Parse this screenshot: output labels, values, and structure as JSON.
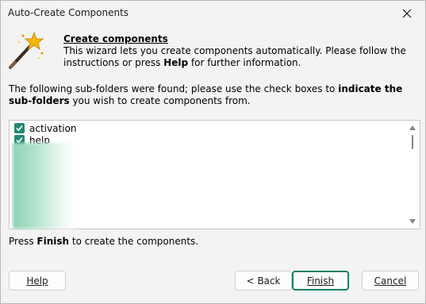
{
  "window": {
    "title": "Auto-Create Components"
  },
  "icons": {
    "close": "close-icon",
    "wand": "magic-wand-icon",
    "checkbox": "checkbox-checked-icon"
  },
  "header": {
    "title": "Create components",
    "desc_pre": "This wizard lets you create components automatically. Please follow the instructions or press ",
    "desc_bold": "Help",
    "desc_post": " for further information."
  },
  "intro": {
    "pre": "The following sub-folders were found; please use the check boxes to ",
    "bold": "indicate the sub-folders",
    "post": " you wish to create components from."
  },
  "folders": [
    {
      "label": "activation",
      "checked": true
    },
    {
      "label": "help",
      "checked": true
    }
  ],
  "hint": {
    "pre": "Press ",
    "bold": "Finish",
    "post": " to create the components."
  },
  "buttons": {
    "help": "Help",
    "back": "< Back",
    "finish": "Finish",
    "cancel": "Cancel"
  },
  "colors": {
    "accent": "#228a71",
    "focus_border": "#1b7f69"
  }
}
